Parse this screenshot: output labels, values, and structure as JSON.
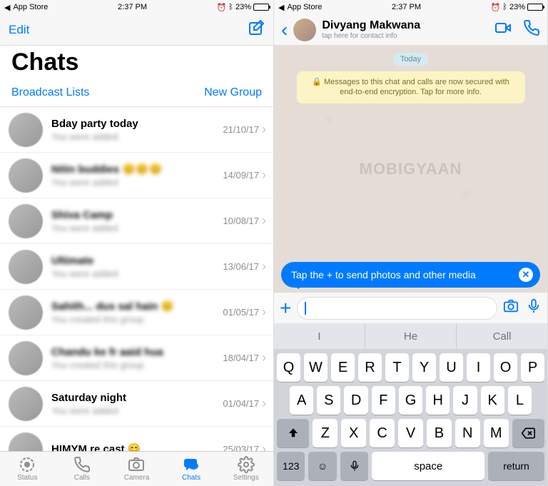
{
  "status": {
    "back_app": "App Store",
    "time": "2:37 PM",
    "battery_percent": "23%"
  },
  "left": {
    "edit": "Edit",
    "title": "Chats",
    "broadcast": "Broadcast Lists",
    "new_group": "New Group",
    "chats": [
      {
        "name": "Bday party today",
        "preview": "You were added",
        "date": "21/10/17",
        "blurred": false
      },
      {
        "name": "Nitin buddies 😊😊😊",
        "preview": "You were added",
        "date": "14/09/17",
        "blurred": true
      },
      {
        "name": "Shiva Camp",
        "preview": "You were added",
        "date": "10/08/17",
        "blurred": true
      },
      {
        "name": "Ultimate",
        "preview": "You were added",
        "date": "13/06/17",
        "blurred": true
      },
      {
        "name": "Sahith... dus sal hain 😊",
        "preview": "You created this group",
        "date": "01/05/17",
        "blurred": true
      },
      {
        "name": "Chandu ke fr aaid hua",
        "preview": "You created this group",
        "date": "18/04/17",
        "blurred": true
      },
      {
        "name": "Saturday night",
        "preview": "You were added",
        "date": "01/04/17",
        "blurred": false
      },
      {
        "name": "HIMYM re cast 😊",
        "preview": "",
        "date": "25/03/17",
        "blurred": false
      }
    ],
    "tabs": {
      "status": "Status",
      "calls": "Calls",
      "camera": "Camera",
      "chats": "Chats",
      "settings": "Settings"
    }
  },
  "right": {
    "contact_name": "Divyang Makwana",
    "contact_sub": "tap here for contact info",
    "date_label": "Today",
    "encryption": "🔒 Messages to this chat and calls are now secured with end-to-end encryption. Tap for more info.",
    "tooltip": "Tap the + to send photos and other media",
    "watermark": "MOBIGYAAN",
    "suggestions": [
      "I",
      "He",
      "Call"
    ],
    "keyboard": {
      "row1": [
        "Q",
        "W",
        "E",
        "R",
        "T",
        "Y",
        "U",
        "I",
        "O",
        "P"
      ],
      "row2": [
        "A",
        "S",
        "D",
        "F",
        "G",
        "H",
        "J",
        "K",
        "L"
      ],
      "row3": [
        "Z",
        "X",
        "C",
        "V",
        "B",
        "N",
        "M"
      ],
      "numkey": "123",
      "space": "space",
      "return": "return"
    }
  }
}
